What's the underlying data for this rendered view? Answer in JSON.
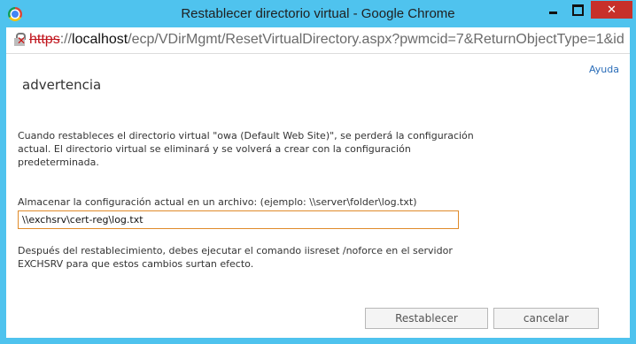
{
  "window": {
    "title": "Restablecer directorio virtual - Google Chrome",
    "icon": "chrome-icon",
    "controls": {
      "minimize": "minimize-icon",
      "maximize": "maximize-icon",
      "close": "close-icon"
    },
    "close_color": "#c7302a",
    "frame_color": "#4fc3ee"
  },
  "address": {
    "scheme": "https",
    "separator": "://",
    "host": "localhost",
    "path": "/ecp/VDirMgmt/ResetVirtualDirectory.aspx?pwmcid=7&ReturnObjectType=1&id",
    "security_icon": "insecure-lock-icon"
  },
  "page": {
    "help_link": "Ayuda",
    "heading": "advertencia",
    "warning_text": "Cuando restableces el directorio virtual \"owa (Default Web Site)\", se perderá la configuración actual. El directorio virtual se eliminará y se volverá a crear con la configuración predeterminada.",
    "store_label": "Almacenar la configuración actual en un archivo: (ejemplo: \\\\server\\folder\\log.txt)",
    "store_value": "\\\\exchsrv\\cert-reg\\log.txt",
    "after_text": "Después del restablecimiento, debes ejecutar el comando iisreset /noforce en el servidor EXCHSRV para que estos cambios surtan efecto.",
    "reset_button": "Restablecer",
    "cancel_button": "cancelar",
    "link_color": "#2a6db8",
    "input_border_color": "#e08b2a"
  }
}
